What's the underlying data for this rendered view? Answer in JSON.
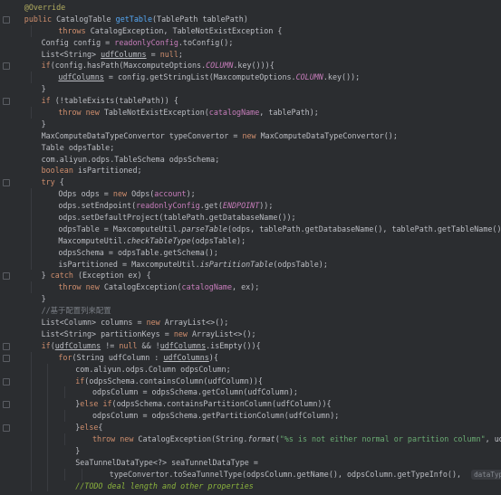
{
  "editor": {
    "language": "Java",
    "lines": [
      {
        "indent": 1,
        "tokens": [
          [
            "ann",
            "@Override"
          ]
        ]
      },
      {
        "indent": 1,
        "fold": true,
        "tokens": [
          [
            "kw",
            "public "
          ],
          [
            "p",
            "CatalogTable "
          ],
          [
            "fn",
            "getTable"
          ],
          [
            "p",
            "(TablePath tablePath)"
          ]
        ]
      },
      {
        "indent": 3,
        "tokens": [
          [
            "kw",
            "throws "
          ],
          [
            "p",
            "CatalogException, TableNotExistException {"
          ]
        ]
      },
      {
        "indent": 2,
        "tokens": [
          [
            "p",
            "Config config = "
          ],
          [
            "field",
            "readonlyConfig"
          ],
          [
            "p",
            ".toConfig();"
          ]
        ]
      },
      {
        "indent": 2,
        "tokens": [
          [
            "p",
            "List<String> "
          ],
          [
            "und",
            "udfColumns"
          ],
          [
            "p",
            " = "
          ],
          [
            "kw",
            "null"
          ],
          [
            "p",
            ";"
          ]
        ]
      },
      {
        "indent": 2,
        "fold": true,
        "tokens": [
          [
            "kw",
            "if"
          ],
          [
            "p",
            "(config.hasPath(MaxcomputeOptions."
          ],
          [
            "const",
            "COLUMN"
          ],
          [
            "p",
            ".key())){"
          ]
        ]
      },
      {
        "indent": 3,
        "tokens": [
          [
            "und",
            "udfColumns"
          ],
          [
            "p",
            " = config.getStringList(MaxcomputeOptions."
          ],
          [
            "const",
            "COLUMN"
          ],
          [
            "p",
            ".key());"
          ]
        ]
      },
      {
        "indent": 2,
        "tokens": [
          [
            "p",
            "}"
          ]
        ]
      },
      {
        "indent": 2,
        "fold": true,
        "tokens": [
          [
            "kw",
            "if "
          ],
          [
            "p",
            "(!tableExists(tablePath)) {"
          ]
        ]
      },
      {
        "indent": 3,
        "tokens": [
          [
            "kw",
            "throw new "
          ],
          [
            "p",
            "TableNotExistException("
          ],
          [
            "field",
            "catalogName"
          ],
          [
            "p",
            ", tablePath);"
          ]
        ]
      },
      {
        "indent": 2,
        "tokens": [
          [
            "p",
            "}"
          ]
        ]
      },
      {
        "indent": 2,
        "tokens": [
          [
            "p",
            "MaxComputeDataTypeConvertor typeConvertor = "
          ],
          [
            "kw",
            "new "
          ],
          [
            "p",
            "MaxComputeDataTypeConvertor();"
          ]
        ]
      },
      {
        "indent": 2,
        "tokens": [
          [
            "p",
            "Table odpsTable;"
          ]
        ]
      },
      {
        "indent": 2,
        "tokens": [
          [
            "p",
            "com.aliyun.odps.TableSchema odpsSchema;"
          ]
        ]
      },
      {
        "indent": 2,
        "tokens": [
          [
            "kw",
            "boolean "
          ],
          [
            "p",
            "isPartitioned;"
          ]
        ]
      },
      {
        "indent": 2,
        "fold": true,
        "tokens": [
          [
            "kw",
            "try "
          ],
          [
            "p",
            "{"
          ]
        ]
      },
      {
        "indent": 3,
        "tokens": [
          [
            "p",
            "Odps odps = "
          ],
          [
            "kw",
            "new "
          ],
          [
            "p",
            "Odps("
          ],
          [
            "field",
            "account"
          ],
          [
            "p",
            ");"
          ]
        ]
      },
      {
        "indent": 3,
        "tokens": [
          [
            "p",
            "odps.setEndpoint("
          ],
          [
            "field",
            "readonlyConfig"
          ],
          [
            "p",
            ".get("
          ],
          [
            "const",
            "ENDPOINT"
          ],
          [
            "p",
            "));"
          ]
        ]
      },
      {
        "indent": 3,
        "tokens": [
          [
            "p",
            "odps.setDefaultProject(tablePath.getDatabaseName());"
          ]
        ]
      },
      {
        "indent": 3,
        "tokens": [
          [
            "p",
            "odpsTable = MaxcomputeUtil."
          ],
          [
            "static",
            "parseTable"
          ],
          [
            "p",
            "(odps, tablePath.getDatabaseName(), tablePath.getTableName());"
          ]
        ]
      },
      {
        "indent": 3,
        "tokens": [
          [
            "p",
            "MaxcomputeUtil."
          ],
          [
            "static",
            "checkTableType"
          ],
          [
            "p",
            "(odpsTable);"
          ]
        ]
      },
      {
        "indent": 3,
        "tokens": [
          [
            "p",
            "odpsSchema = odpsTable.getSchema();"
          ]
        ]
      },
      {
        "indent": 3,
        "tokens": [
          [
            "p",
            "isPartitioned = MaxcomputeUtil."
          ],
          [
            "static",
            "isPartitionTable"
          ],
          [
            "p",
            "(odpsTable);"
          ]
        ]
      },
      {
        "indent": 2,
        "fold": true,
        "tokens": [
          [
            "p",
            "} "
          ],
          [
            "kw",
            "catch "
          ],
          [
            "p",
            "(Exception ex) {"
          ]
        ]
      },
      {
        "indent": 3,
        "tokens": [
          [
            "kw",
            "throw new "
          ],
          [
            "p",
            "CatalogException("
          ],
          [
            "field",
            "catalogName"
          ],
          [
            "p",
            ", ex);"
          ]
        ]
      },
      {
        "indent": 2,
        "tokens": [
          [
            "p",
            "}"
          ]
        ]
      },
      {
        "indent": 2,
        "tokens": [
          [
            "cmt",
            "//基于配置列来配置"
          ]
        ]
      },
      {
        "indent": 2,
        "tokens": [
          [
            "p",
            "List<Column> columns = "
          ],
          [
            "kw",
            "new "
          ],
          [
            "p",
            "ArrayList<>();"
          ]
        ]
      },
      {
        "indent": 2,
        "tokens": [
          [
            "p",
            "List<String> partitionKeys = "
          ],
          [
            "kw",
            "new "
          ],
          [
            "p",
            "ArrayList<>();"
          ]
        ]
      },
      {
        "indent": 2,
        "fold": true,
        "tokens": [
          [
            "kw",
            "if"
          ],
          [
            "p",
            "("
          ],
          [
            "und",
            "udfColumns"
          ],
          [
            "p",
            " != "
          ],
          [
            "kw",
            "null "
          ],
          [
            "p",
            "&& !"
          ],
          [
            "und",
            "udfColumns"
          ],
          [
            "p",
            ".isEmpty()){"
          ]
        ]
      },
      {
        "indent": 3,
        "fold": true,
        "tokens": [
          [
            "kw",
            "for"
          ],
          [
            "p",
            "(String udfColumn : "
          ],
          [
            "und",
            "udfColumns"
          ],
          [
            "p",
            "){"
          ]
        ]
      },
      {
        "indent": 4,
        "tokens": [
          [
            "p",
            "com.aliyun.odps.Column odpsColumn;"
          ]
        ]
      },
      {
        "indent": 4,
        "fold": true,
        "tokens": [
          [
            "kw",
            "if"
          ],
          [
            "p",
            "(odpsSchema.containsColumn(udfColumn)){"
          ]
        ]
      },
      {
        "indent": 5,
        "tokens": [
          [
            "p",
            "odpsColumn = odpsSchema.getColumn(udfColumn);"
          ]
        ]
      },
      {
        "indent": 4,
        "fold": true,
        "tokens": [
          [
            "p",
            "}"
          ],
          [
            "kw",
            "else if"
          ],
          [
            "p",
            "(odpsSchema.containsPartitionColumn(udfColumn)){"
          ]
        ]
      },
      {
        "indent": 5,
        "tokens": [
          [
            "p",
            "odpsColumn = odpsSchema.getPartitionColumn(udfColumn);"
          ]
        ]
      },
      {
        "indent": 4,
        "fold": true,
        "tokens": [
          [
            "p",
            "}"
          ],
          [
            "kw",
            "else"
          ],
          [
            "p",
            "{"
          ]
        ]
      },
      {
        "indent": 5,
        "tokens": [
          [
            "kw",
            "throw new "
          ],
          [
            "p",
            "CatalogException(String."
          ],
          [
            "static",
            "format"
          ],
          [
            "p",
            "("
          ],
          [
            "str",
            "\"%s is not either normal or partition column\""
          ],
          [
            "p",
            ", udfColum"
          ]
        ]
      },
      {
        "indent": 4,
        "tokens": [
          [
            "p",
            "}"
          ]
        ]
      },
      {
        "indent": 4,
        "tokens": [
          [
            "p",
            "SeaTunnelDataType<?> seaTunnelDataType ="
          ]
        ]
      },
      {
        "indent": 6,
        "tokens": [
          [
            "p",
            "typeConvertor.toSeaTunnelType(odpsColumn.getName(), odpsColumn.getTypeInfo(), "
          ],
          [
            "hint",
            "dataTypeProperties"
          ]
        ]
      },
      {
        "indent": 4,
        "tokens": [
          [
            "cmt-todo",
            "//TODO deal length and other properties"
          ]
        ]
      }
    ]
  }
}
